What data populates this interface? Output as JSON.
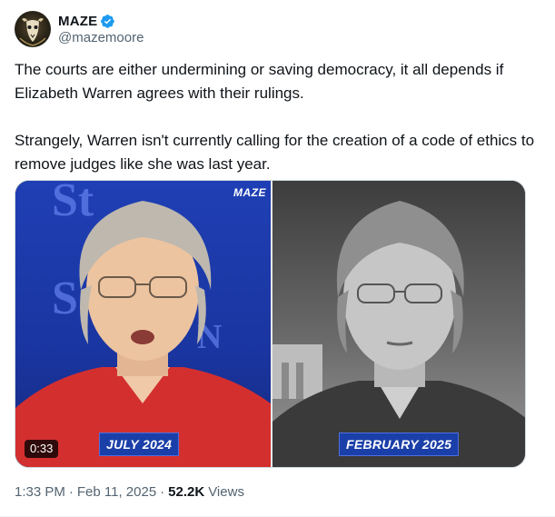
{
  "author": {
    "display_name": "MAZE",
    "handle": "@mazemoore",
    "verified": true,
    "avatar_icon": "maze-goat-skull-avatar"
  },
  "tweet": {
    "paragraphs": [
      "The courts are either undermining or saving democracy, it all depends if Elizabeth Warren agrees with their rulings.",
      "Strangely, Warren isn't currently calling for the creation of a code of ethics to remove judges like she was last year."
    ]
  },
  "media": {
    "type": "video",
    "duration": "0:33",
    "watermark": "MAZE",
    "left_caption": "JULY 2024",
    "right_caption": "FEBRUARY 2025"
  },
  "meta": {
    "time": "1:33 PM",
    "separator": "·",
    "date": "Feb 11, 2025",
    "views_count": "52.2K",
    "views_label": "Views"
  },
  "colors": {
    "verified_badge": "#1d9bf0",
    "secondary_text": "#536471",
    "primary_text": "#0f1419",
    "caption_bg": "#1b3fa8"
  }
}
